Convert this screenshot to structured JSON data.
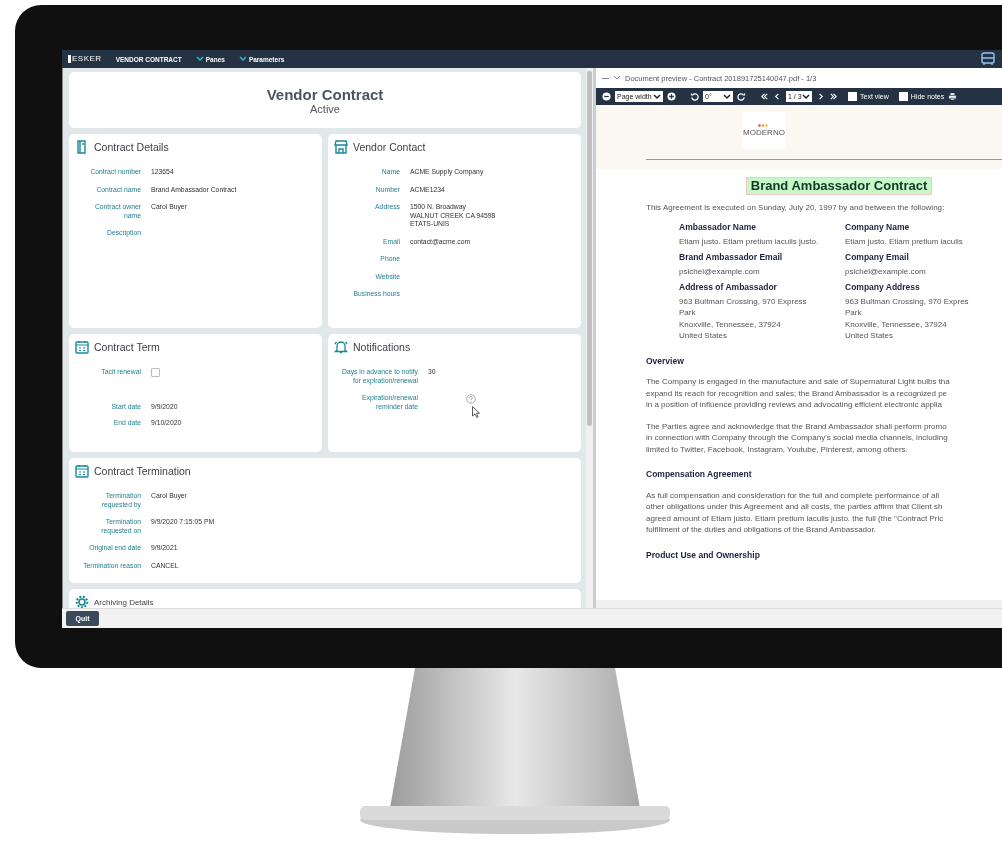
{
  "app_bar": {
    "logo": "ESKER",
    "title": "VENDOR CONTRACT",
    "menus": [
      "Panes",
      "Parameters"
    ]
  },
  "header": {
    "title": "Vendor Contract",
    "status": "Active"
  },
  "sections": [
    {
      "title": "Contract Details",
      "fields": [
        {
          "kind": "text",
          "label": "Contract number",
          "value": "123654"
        },
        {
          "kind": "text",
          "label": "Contract name",
          "value": "Brand Ambassador Contract"
        },
        {
          "kind": "text",
          "label": "Contract owner\nname",
          "value": "Carol Buyer"
        },
        {
          "kind": "text",
          "label": "Description"
        }
      ]
    },
    {
      "title": "Vendor Contact",
      "fields": [
        {
          "kind": "text",
          "label": "Name",
          "value": "ACME Supply Company"
        },
        {
          "kind": "text",
          "label": "Number",
          "value": "ACME1234"
        },
        {
          "kind": "lines",
          "label": "Address",
          "value": [
            "1500 N. Broadway",
            "WALNUT CREEK CA 94598",
            "ETATS-UNIS"
          ]
        },
        {
          "kind": "text",
          "label": "Email",
          "value": "contact@acme.com"
        },
        {
          "kind": "text",
          "label": "Phone"
        },
        {
          "kind": "text",
          "label": "Website"
        },
        {
          "kind": "text",
          "label": "Business hours"
        }
      ]
    },
    {
      "title": "Contract Term",
      "fields": [
        {
          "kind": "checkbox",
          "label": "Tacit renewal",
          "checked": false
        },
        {
          "kind": "text",
          "label": "Start date",
          "value": "9/9/2020"
        },
        {
          "kind": "text",
          "label": "End date",
          "value": "9/10/2020"
        }
      ]
    },
    {
      "title": "Notifications",
      "fields": [
        {
          "kind": "text",
          "label": "Days in advance to notify\nfor expiration/renewal",
          "value": "30"
        },
        {
          "kind": "help",
          "label": "Expiration/renewal\nreminder date"
        }
      ]
    },
    {
      "title": "Contract Termination",
      "fields": [
        {
          "kind": "text",
          "label": "Termination\nrequested by",
          "value": "Carol Buyer"
        },
        {
          "kind": "text",
          "label": "Termination\nrequested on",
          "value": "9/9/2020 7:15:05 PM"
        },
        {
          "kind": "text",
          "label": "Original end date",
          "value": "9/9/2021"
        },
        {
          "kind": "text",
          "label": "Termination reason",
          "value": "CANCEL"
        }
      ]
    },
    {
      "title": "Archiving Details"
    }
  ],
  "preview": {
    "title": "Document preview - Contract 201891725140047.pdf - 1/3",
    "toolbar": {
      "zoom": "Page width",
      "rotation": "0°",
      "page": "1 / 3",
      "options": [
        {
          "label": "Text view",
          "checked": false
        },
        {
          "label": "Hide notes",
          "checked": false
        }
      ]
    },
    "document": {
      "logo": "MODERNO",
      "heading": "Brand Ambassador Contract",
      "intro": "This Agreement is executed on Sunday, July 20, 1997 by and between the following:",
      "parties": [
        {
          "label": "Ambassador Name",
          "value": [
            "Etiam justo. Etiam pretium iaculis justo."
          ]
        },
        {
          "label": "Company Name",
          "value": [
            "Etiam justo. Etiam pretium iaculis"
          ]
        },
        {
          "label": "Brand Ambassador Email",
          "value": [
            "psichel@example.com"
          ]
        },
        {
          "label": "Company Email",
          "value": [
            "psichel@example.com"
          ]
        },
        {
          "label": "Address of Ambassador",
          "value": [
            "963 Bultman Crossing, 970 Express",
            "Park",
            "Knoxville, Tennessee, 37924",
            "United States"
          ]
        },
        {
          "label": "Company Address",
          "value": [
            "963 Bultman Crossing, 970 Expres",
            "Park",
            "Knoxville, Tennessee, 37924",
            "United States"
          ]
        }
      ],
      "sections": [
        {
          "heading": "Overview",
          "paragraphs": [
            [
              "The Company is engaged in the manufacture and sale of Supernatural Light bulbs tha",
              "expand its reach for recognition and sales; the Brand Ambassador is a recognized pe",
              "in a position of influence providing reviews and advocating efficient electronic applia"
            ],
            [
              "The Parties agree and acknowledge that the Brand Ambassador shall perform promo",
              "in connection with Company through the Company's social media channels, including",
              "limited to Twitter, Facebook, Instagram, Youtube,  Pinterest, among others."
            ]
          ]
        },
        {
          "heading": "Compensation Agreement",
          "paragraphs": [
            [
              "As full compensation and consideration for the full and complete performance of all",
              "other obligations under this Agreement and all costs, the parties affirm that Client sh",
              "agreed amount of Etiam justo. Etiam pretium iaculis justo. the full (the \"Contract Pric",
              "fulfillment of the duties and obligations of the Brand Ambassador."
            ]
          ]
        },
        {
          "heading": "Product Use and Ownership"
        }
      ]
    }
  },
  "footer": {
    "buttons": [
      "Quit"
    ]
  }
}
